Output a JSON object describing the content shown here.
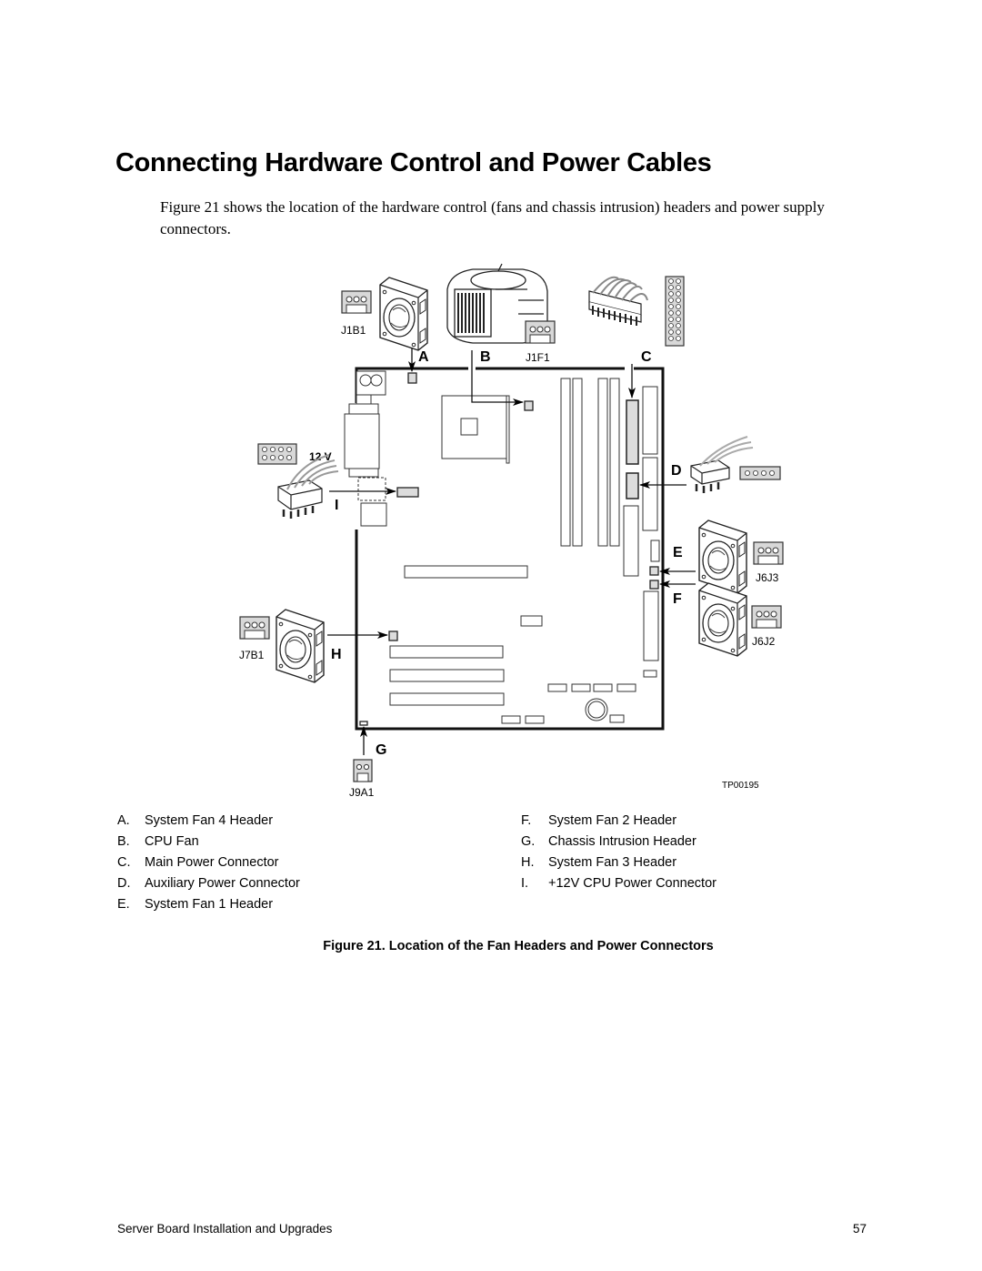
{
  "page": {
    "title": "Connecting Hardware Control and Power Cables",
    "intro": "Figure 21 shows the location of the hardware control (fans and chassis intrusion) headers and power supply connectors."
  },
  "figure": {
    "callouts": {
      "A": "A",
      "B": "B",
      "C": "C",
      "D": "D",
      "E": "E",
      "F": "F",
      "G": "G",
      "H": "H",
      "I": "I"
    },
    "connector_labels": {
      "j1b1": "J1B1",
      "j1f1": "J1F1",
      "j6j3": "J6J3",
      "j6j2": "J6J2",
      "j7b1": "J7B1",
      "j9a1": "J9A1",
      "volt_12v": "12 V"
    },
    "figure_id": "TP00195"
  },
  "legend": {
    "left": [
      {
        "letter": "A.",
        "text": "System Fan 4 Header"
      },
      {
        "letter": "B.",
        "text": "CPU Fan"
      },
      {
        "letter": "C.",
        "text": "Main Power Connector"
      },
      {
        "letter": "D.",
        "text": "Auxiliary Power Connector"
      },
      {
        "letter": "E.",
        "text": "System Fan 1 Header"
      }
    ],
    "right": [
      {
        "letter": "F.",
        "text": "System Fan 2 Header"
      },
      {
        "letter": "G.",
        "text": "Chassis Intrusion Header"
      },
      {
        "letter": "H.",
        "text": "System Fan 3 Header"
      },
      {
        "letter": "I.",
        "text": "+12V CPU Power Connector"
      }
    ]
  },
  "caption": "Figure 21. Location of the Fan Headers and Power Connectors",
  "footer": {
    "left": "Server Board Installation and Upgrades",
    "page_number": "57"
  }
}
